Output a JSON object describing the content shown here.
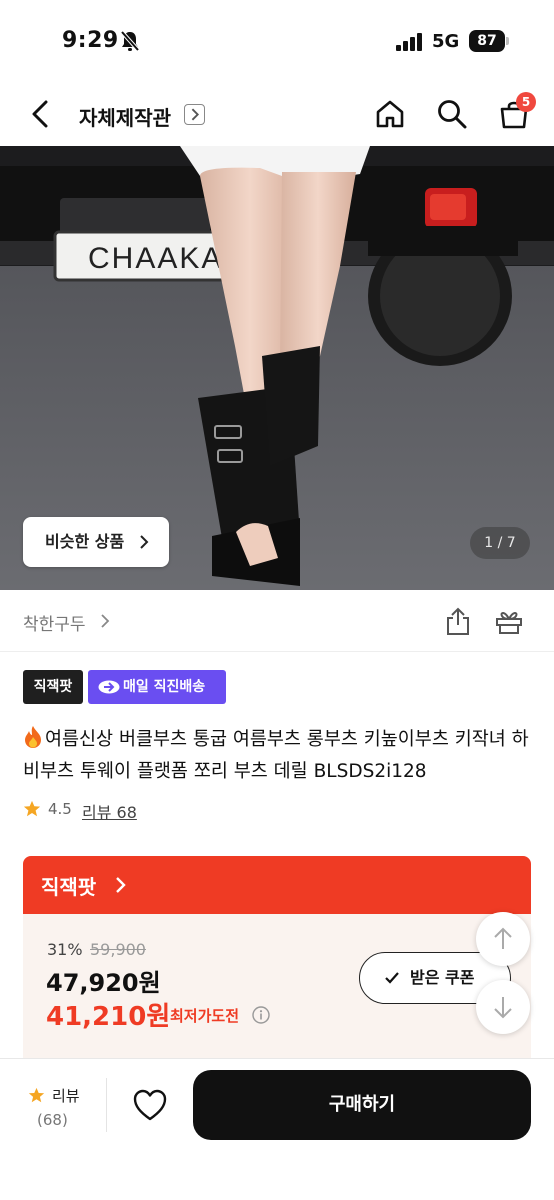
{
  "status_bar": {
    "time": "9:29",
    "network": "5G",
    "battery": "87"
  },
  "header": {
    "store_title": "자체제작관",
    "cart_count": "5"
  },
  "product_image": {
    "plate_text": "CHAAKA",
    "similar_button_label": "비슷한 상품",
    "counter": "1 / 7"
  },
  "brand": {
    "name": "착한구두"
  },
  "tags": {
    "direct": "직잭팟",
    "delivery": "매일 직진배송"
  },
  "product": {
    "title": "여름신상 버클부츠 통굽 여름부츠 롱부츠 키높이부츠 키작녀 하비부츠 투웨이 플랫폼 쪼리 부츠 데릴 BLSDS2i128",
    "rating": "4.5",
    "review_link": "리뷰 68"
  },
  "zikzak": {
    "label": "직잭팟",
    "discount_percent": "31%",
    "original_price": "59,900",
    "sale_price": "47,920원",
    "lowest_price": "41,210원",
    "lowest_label": "최저가도전",
    "coupon_button": "받은 쿠폰"
  },
  "bottom_bar": {
    "review_label": "리뷰",
    "review_count": "(68)",
    "buy_label": "구매하기"
  },
  "colors": {
    "accent_red": "#ef3b24",
    "delivery_purple": "#6a4ef1",
    "star": "#f5a623"
  }
}
